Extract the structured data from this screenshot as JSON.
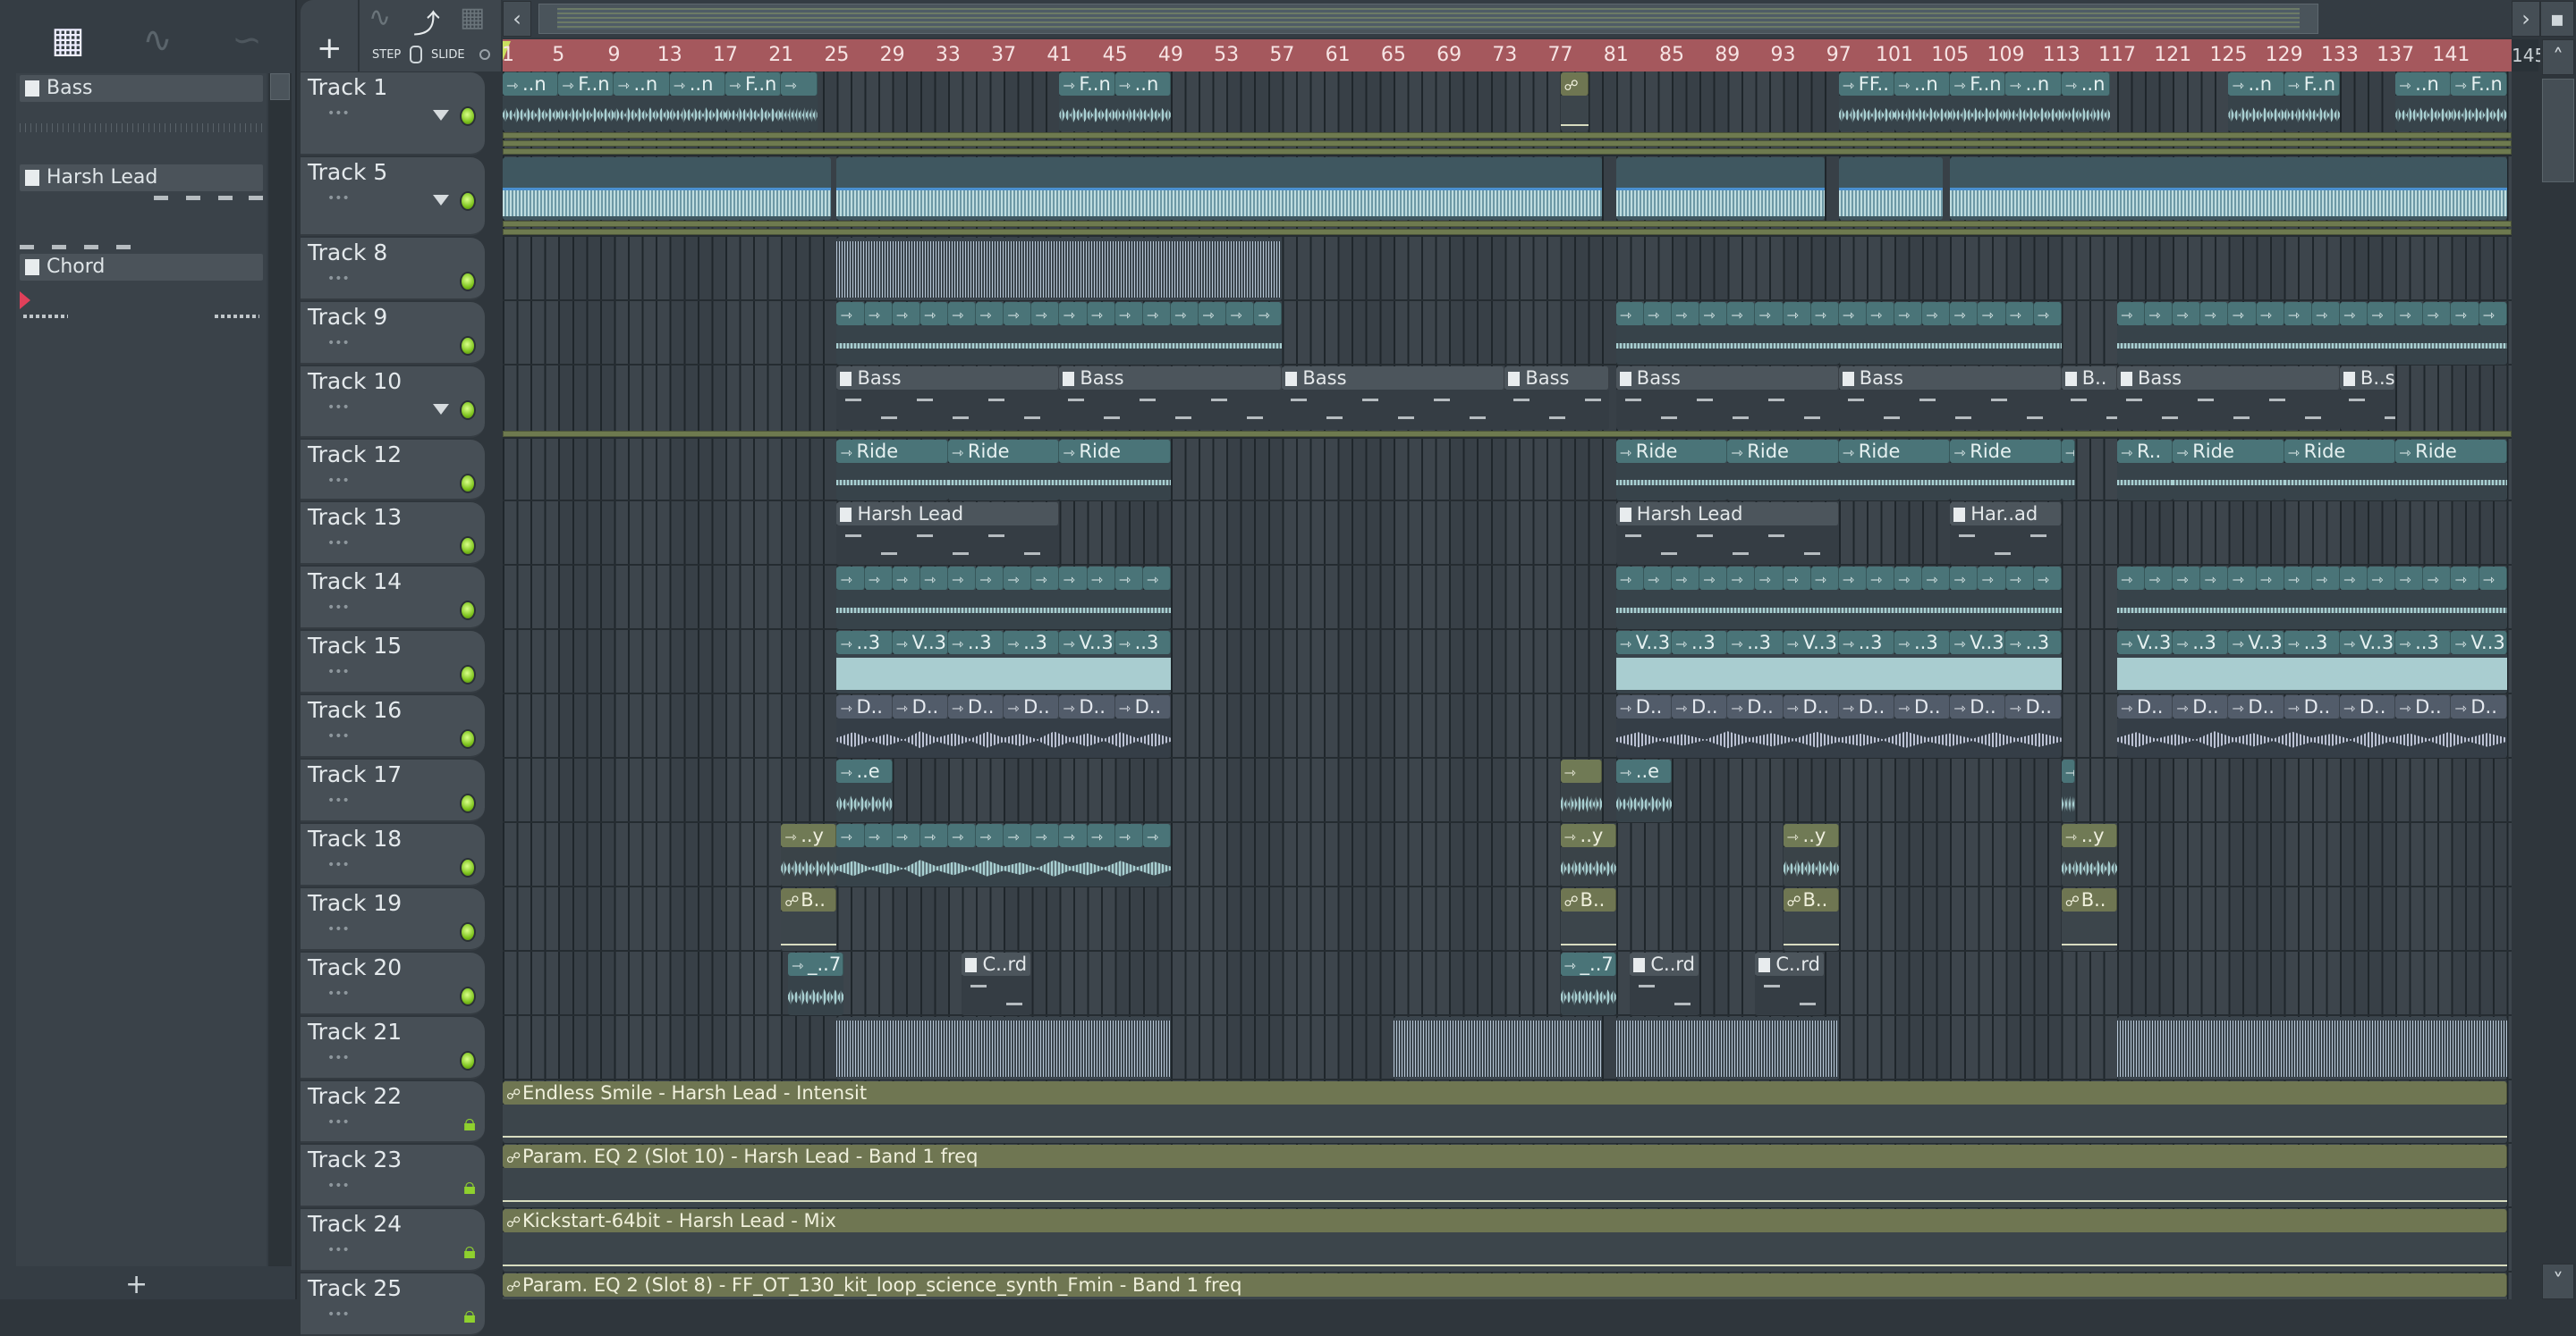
{
  "pattern_picker": {
    "tabs": [
      "piano-roll",
      "audio",
      "automation"
    ],
    "patterns": [
      {
        "name": "Bass"
      },
      {
        "name": "Harsh Lead"
      },
      {
        "name": "Chord"
      }
    ],
    "add_label": "+"
  },
  "toolbar": {
    "add_label": "+",
    "step_label": "STEP",
    "slide_label": "SLIDE"
  },
  "ruler_labels": [
    "1",
    "5",
    "9",
    "13",
    "17",
    "21",
    "25",
    "29",
    "33",
    "37",
    "41",
    "45",
    "49",
    "53",
    "57",
    "61",
    "65",
    "69",
    "73",
    "77",
    "81",
    "85",
    "89",
    "93",
    "97",
    "101",
    "105",
    "109",
    "113",
    "117",
    "121",
    "125",
    "129",
    "133",
    "137",
    "141"
  ],
  "ruler_end": "145",
  "colors": {
    "ruler": "#a5585d",
    "audio": "#4a7478",
    "automation": "#6f7652",
    "pattern": "#4c555c",
    "led": "#7fc41e"
  },
  "tracks": [
    {
      "name": "Track 1",
      "state": "led",
      "menu": true,
      "lanes": 3,
      "clips": [
        {
          "s": 1,
          "l": 4,
          "t": "audio",
          "labels": [
            "..n"
          ]
        },
        {
          "s": 5,
          "l": 4,
          "t": "audio",
          "labels": [
            "F..n"
          ]
        },
        {
          "s": 9,
          "l": 4,
          "t": "audio",
          "labels": [
            "..n"
          ]
        },
        {
          "s": 13,
          "l": 4,
          "t": "audio",
          "labels": [
            "..n"
          ]
        },
        {
          "s": 17,
          "l": 4,
          "t": "audio",
          "labels": [
            "F..n"
          ]
        },
        {
          "s": 21,
          "l": 2.6,
          "t": "audio",
          "labels": [
            ""
          ]
        },
        {
          "s": 41,
          "l": 4,
          "t": "audio",
          "labels": [
            "F..n"
          ]
        },
        {
          "s": 45,
          "l": 4,
          "t": "audio",
          "labels": [
            "..n"
          ]
        },
        {
          "s": 77,
          "l": 2,
          "t": "auto",
          "labels": [
            ""
          ]
        },
        {
          "s": 97,
          "l": 4,
          "t": "audio",
          "labels": [
            "FF.."
          ]
        },
        {
          "s": 101,
          "l": 4,
          "t": "audio",
          "labels": [
            "..n"
          ]
        },
        {
          "s": 105,
          "l": 4,
          "t": "audio",
          "labels": [
            "F..n"
          ]
        },
        {
          "s": 109,
          "l": 4,
          "t": "audio",
          "labels": [
            "..n"
          ]
        },
        {
          "s": 113,
          "l": 3.5,
          "t": "audio",
          "labels": [
            "..n"
          ]
        },
        {
          "s": 125,
          "l": 4,
          "t": "audio",
          "labels": [
            "..n"
          ]
        },
        {
          "s": 129,
          "l": 4,
          "t": "audio",
          "labels": [
            "F..n"
          ]
        },
        {
          "s": 137,
          "l": 4,
          "t": "audio",
          "labels": [
            "..n"
          ]
        },
        {
          "s": 141,
          "l": 4,
          "t": "audio",
          "labels": [
            "F..n"
          ]
        }
      ]
    },
    {
      "name": "Track 5",
      "state": "led",
      "menu": true,
      "lanes": 2,
      "clips": [
        {
          "s": 1,
          "l": 23.6,
          "t": "long"
        },
        {
          "s": 25,
          "l": 55,
          "t": "long"
        },
        {
          "s": 81,
          "l": 15,
          "t": "long"
        },
        {
          "s": 97,
          "l": 7.5,
          "t": "long"
        },
        {
          "s": 105,
          "l": 40,
          "t": "long"
        }
      ]
    },
    {
      "name": "Track 8",
      "state": "led",
      "clips": [
        {
          "s": 25,
          "l": 32,
          "t": "lines"
        }
      ]
    },
    {
      "name": "Track 9",
      "state": "led",
      "clips": [
        {
          "s": 25,
          "l": 32,
          "t": "audio",
          "split": 16,
          "wave": "flat"
        },
        {
          "s": 81,
          "l": 16,
          "t": "audio",
          "split": 8,
          "wave": "flat"
        },
        {
          "s": 97,
          "l": 16,
          "t": "audio",
          "split": 8,
          "wave": "flat"
        },
        {
          "s": 117,
          "l": 28,
          "t": "audio",
          "split": 14,
          "wave": "flat"
        }
      ]
    },
    {
      "name": "Track 10",
      "state": "led",
      "menu": true,
      "lanes": 1,
      "clips": [
        {
          "s": 25,
          "l": 16,
          "t": "pattern",
          "labels": [
            "Bass"
          ]
        },
        {
          "s": 41,
          "l": 16,
          "t": "pattern",
          "labels": [
            "Bass"
          ]
        },
        {
          "s": 57,
          "l": 16,
          "t": "pattern",
          "labels": [
            "Bass"
          ]
        },
        {
          "s": 73,
          "l": 7.5,
          "t": "pattern",
          "labels": [
            "Bass"
          ]
        },
        {
          "s": 81,
          "l": 16,
          "t": "pattern",
          "labels": [
            "Bass"
          ]
        },
        {
          "s": 97,
          "l": 16,
          "t": "pattern",
          "labels": [
            "Bass"
          ]
        },
        {
          "s": 113,
          "l": 4,
          "t": "pattern",
          "labels": [
            "B.."
          ]
        },
        {
          "s": 117,
          "l": 16,
          "t": "pattern",
          "labels": [
            "Bass"
          ]
        },
        {
          "s": 133,
          "l": 4,
          "t": "pattern",
          "labels": [
            "B..s"
          ]
        }
      ]
    },
    {
      "name": "Track 12",
      "state": "led",
      "clips": [
        {
          "s": 25,
          "l": 8,
          "t": "audio",
          "labels": [
            "Ride"
          ],
          "wave": "flat"
        },
        {
          "s": 33,
          "l": 8,
          "t": "audio",
          "labels": [
            "Ride"
          ],
          "wave": "flat"
        },
        {
          "s": 41,
          "l": 8,
          "t": "audio",
          "labels": [
            "Ride"
          ],
          "wave": "flat"
        },
        {
          "s": 81,
          "l": 8,
          "t": "audio",
          "labels": [
            "Ride"
          ],
          "wave": "flat"
        },
        {
          "s": 89,
          "l": 8,
          "t": "audio",
          "labels": [
            "Ride"
          ],
          "wave": "flat"
        },
        {
          "s": 97,
          "l": 8,
          "t": "audio",
          "labels": [
            "Ride"
          ],
          "wave": "flat"
        },
        {
          "s": 105,
          "l": 8,
          "t": "audio",
          "labels": [
            "Ride"
          ],
          "wave": "flat"
        },
        {
          "s": 113,
          "l": 1,
          "t": "audio",
          "labels": [
            ""
          ],
          "wave": "flat"
        },
        {
          "s": 117,
          "l": 4,
          "t": "audio",
          "labels": [
            "R.."
          ],
          "wave": "flat"
        },
        {
          "s": 121,
          "l": 8,
          "t": "audio",
          "labels": [
            "Ride"
          ],
          "wave": "flat"
        },
        {
          "s": 129,
          "l": 8,
          "t": "audio",
          "labels": [
            "Ride"
          ],
          "wave": "flat"
        },
        {
          "s": 137,
          "l": 8,
          "t": "audio",
          "labels": [
            "Ride"
          ],
          "wave": "flat"
        }
      ]
    },
    {
      "name": "Track 13",
      "state": "led",
      "clips": [
        {
          "s": 25,
          "l": 16,
          "t": "pattern",
          "labels": [
            "Harsh Lead"
          ]
        },
        {
          "s": 81,
          "l": 16,
          "t": "pattern",
          "labels": [
            "Harsh Lead"
          ]
        },
        {
          "s": 105,
          "l": 8,
          "t": "pattern",
          "labels": [
            "Har..ad"
          ]
        }
      ]
    },
    {
      "name": "Track 14",
      "state": "led",
      "clips": [
        {
          "s": 25,
          "l": 24,
          "t": "audio",
          "split": 12,
          "wave": "flat"
        },
        {
          "s": 81,
          "l": 32,
          "t": "audio",
          "split": 16,
          "wave": "flat"
        },
        {
          "s": 117,
          "l": 28,
          "t": "audio",
          "split": 14,
          "wave": "flat"
        }
      ]
    },
    {
      "name": "Track 15",
      "state": "led",
      "clips": [
        {
          "s": 25,
          "l": 24,
          "t": "audio",
          "labels": [
            "..3",
            "V..3",
            "..3",
            "..3",
            "V..3",
            "..3"
          ],
          "wave": "tall"
        },
        {
          "s": 81,
          "l": 32,
          "t": "audio",
          "labels": [
            "V..3",
            "..3",
            "..3",
            "V..3",
            "..3",
            "..3",
            "V..3",
            "..3"
          ],
          "wave": "tall"
        },
        {
          "s": 117,
          "l": 28,
          "t": "audio",
          "labels": [
            "V..3",
            "..3",
            "V..3",
            "..3",
            "V..3",
            "..3",
            "V..3"
          ],
          "wave": "tall"
        }
      ]
    },
    {
      "name": "Track 16",
      "state": "led",
      "clips": [
        {
          "s": 25,
          "l": 24,
          "t": "drum",
          "labels": [
            "D..",
            "D..",
            "D..",
            "D..",
            "D..",
            "D.."
          ]
        },
        {
          "s": 81,
          "l": 32,
          "t": "drum",
          "labels": [
            "D..",
            "D..",
            "D..",
            "D..",
            "D..",
            "D..",
            "D..",
            "D.."
          ]
        },
        {
          "s": 117,
          "l": 28,
          "t": "drum",
          "labels": [
            "D..",
            "D..",
            "D..",
            "D..",
            "D..",
            "D..",
            "D.."
          ]
        }
      ]
    },
    {
      "name": "Track 17",
      "state": "led",
      "clips": [
        {
          "s": 25,
          "l": 4,
          "t": "audio",
          "labels": [
            "..e"
          ]
        },
        {
          "s": 77,
          "l": 3,
          "t": "audio2",
          "labels": [
            ""
          ]
        },
        {
          "s": 81,
          "l": 4,
          "t": "audio",
          "labels": [
            "..e"
          ]
        },
        {
          "s": 113,
          "l": 1,
          "t": "audio",
          "labels": [
            ""
          ]
        }
      ]
    },
    {
      "name": "Track 18",
      "state": "led",
      "clips": [
        {
          "s": 21,
          "l": 4,
          "t": "audio2",
          "labels": [
            "..y"
          ]
        },
        {
          "s": 25,
          "l": 24,
          "t": "audio",
          "split": 12
        },
        {
          "s": 77,
          "l": 4,
          "t": "audio2",
          "labels": [
            "..y"
          ]
        },
        {
          "s": 93,
          "l": 4,
          "t": "audio2",
          "labels": [
            "..y"
          ]
        },
        {
          "s": 113,
          "l": 4,
          "t": "audio2",
          "labels": [
            "..y"
          ]
        }
      ]
    },
    {
      "name": "Track 19",
      "state": "led",
      "clips": [
        {
          "s": 21,
          "l": 4,
          "t": "auto",
          "labels": [
            "B.."
          ]
        },
        {
          "s": 77,
          "l": 4,
          "t": "auto",
          "labels": [
            "B.."
          ]
        },
        {
          "s": 93,
          "l": 4,
          "t": "auto",
          "labels": [
            "B.."
          ]
        },
        {
          "s": 113,
          "l": 4,
          "t": "auto",
          "labels": [
            "B.."
          ]
        }
      ]
    },
    {
      "name": "Track 20",
      "state": "led",
      "clips": [
        {
          "s": 21.5,
          "l": 4,
          "t": "audio",
          "labels": [
            "_..7"
          ]
        },
        {
          "s": 34,
          "l": 5,
          "t": "pattern",
          "labels": [
            "C..rd"
          ]
        },
        {
          "s": 77,
          "l": 4,
          "t": "audio",
          "labels": [
            "_..7"
          ]
        },
        {
          "s": 82,
          "l": 5,
          "t": "pattern",
          "labels": [
            "C..rd"
          ]
        },
        {
          "s": 91,
          "l": 5,
          "t": "pattern",
          "labels": [
            "C..rd"
          ]
        }
      ]
    },
    {
      "name": "Track 21",
      "state": "led",
      "clips": [
        {
          "s": 25,
          "l": 24,
          "t": "lines"
        },
        {
          "s": 65,
          "l": 15,
          "t": "lines"
        },
        {
          "s": 81,
          "l": 16,
          "t": "lines"
        },
        {
          "s": 117,
          "l": 28,
          "t": "lines"
        }
      ]
    },
    {
      "name": "Track 22",
      "state": "lock",
      "clips": [
        {
          "s": 1,
          "l": 144,
          "t": "auto",
          "labels": [
            "Endless Smile - Harsh Lead - Intensit"
          ],
          "curve": true
        }
      ]
    },
    {
      "name": "Track 23",
      "state": "lock",
      "clips": [
        {
          "s": 1,
          "l": 144,
          "t": "auto",
          "labels": [
            "Param. EQ 2 (Slot 10) - Harsh Lead - Band 1 freq"
          ],
          "curve": true
        }
      ]
    },
    {
      "name": "Track 24",
      "state": "lock",
      "clips": [
        {
          "s": 1,
          "l": 144,
          "t": "auto",
          "labels": [
            "Kickstart-64bit - Harsh Lead - Mix"
          ],
          "curve": true
        }
      ]
    },
    {
      "name": "Track 25",
      "state": "lock",
      "clips": [
        {
          "s": 1,
          "l": 144,
          "t": "auto",
          "labels": [
            "Param. EQ 2 (Slot 8) - FF_OT_130_kit_loop_science_synth_Fmin - Band 1 freq"
          ]
        }
      ]
    }
  ]
}
